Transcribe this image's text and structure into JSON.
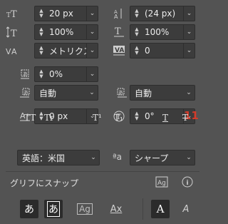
{
  "row1": {
    "font_size": "20 px",
    "leading": "(24 px)"
  },
  "row2": {
    "vertical_scale": "100%",
    "horizontal_scale": "100%"
  },
  "row3": {
    "kerning": "メトリクス",
    "tracking": "0"
  },
  "row4": {
    "tsume": "0%"
  },
  "row5": {
    "aki_left": "自動",
    "aki_right": "自動"
  },
  "row6": {
    "baseline_shift": "0 px",
    "rotation": "0°"
  },
  "row6_annotation": "11",
  "style_buttons": [
    "TT",
    "Tr",
    "T¹",
    "T₁",
    "T",
    "T"
  ],
  "language": "英語：米国",
  "antialias": "シャープ",
  "aa_icon_text": "ªa",
  "snap_label": "グリフにスナップ",
  "snap_buttons": [
    "あ",
    "あ",
    "Ag",
    "Ax",
    "A",
    "A"
  ],
  "icons": {
    "font_size": "font-size-icon",
    "leading": "leading-icon",
    "vertical_scale": "vertical-scale-icon",
    "horizontal_scale": "horizontal-scale-icon",
    "kerning": "kerning-icon",
    "tracking": "tracking-icon",
    "tsume": "tsume-icon",
    "aki_left": "aki-left-icon",
    "aki_right": "aki-right-icon",
    "baseline": "baseline-shift-icon",
    "rotation": "character-rotation-icon",
    "info": "info-icon"
  }
}
